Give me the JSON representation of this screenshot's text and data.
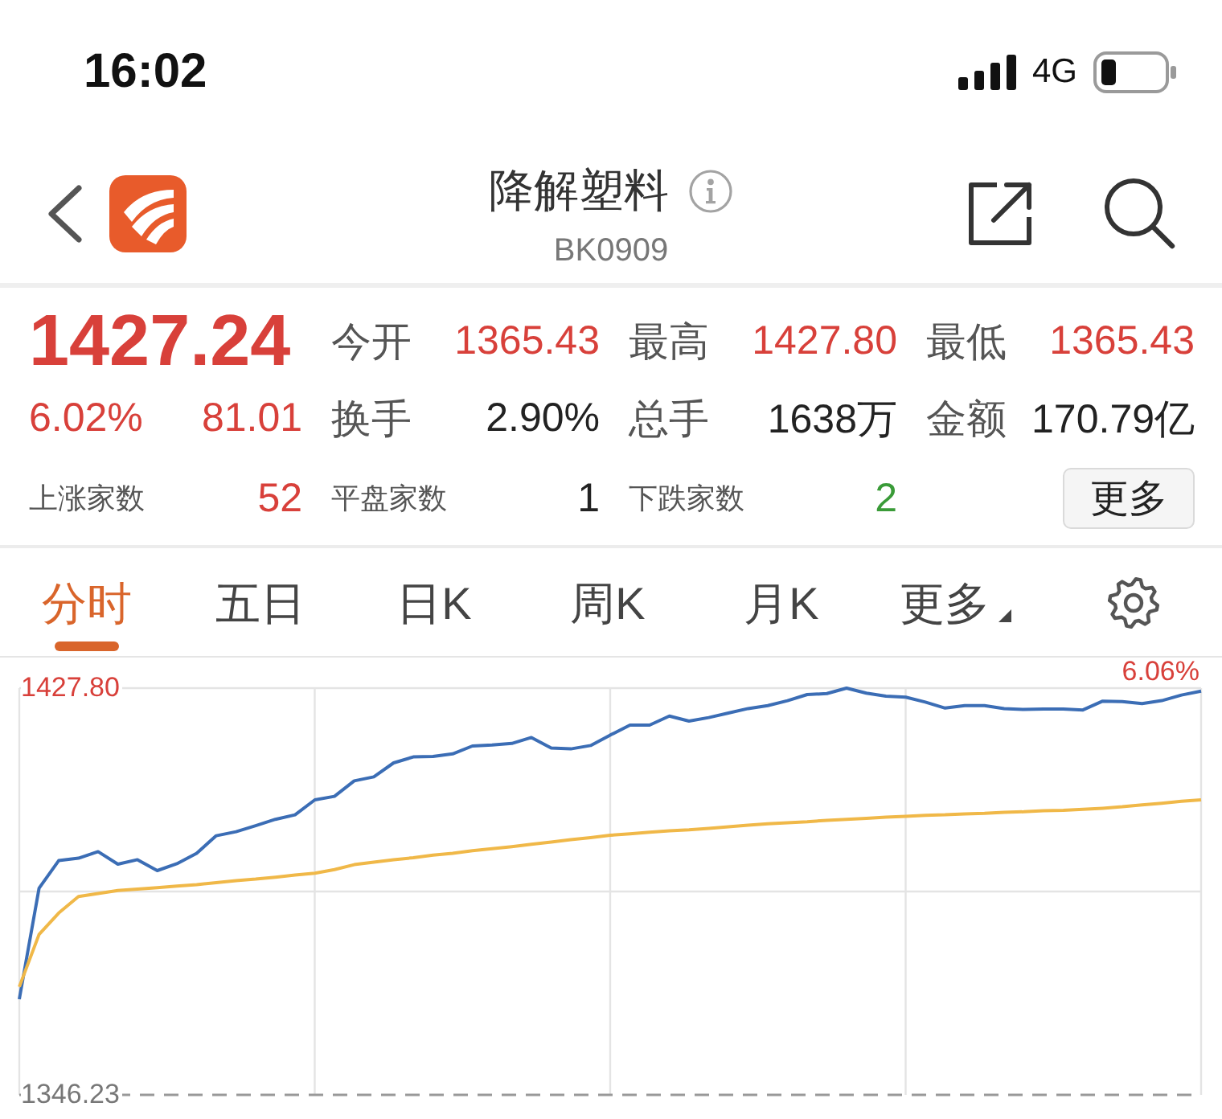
{
  "status_bar": {
    "time": "16:02",
    "network": "4G"
  },
  "header": {
    "title": "降解塑料",
    "code": "BK0909"
  },
  "quote": {
    "price": "1427.24",
    "change_pct": "6.02%",
    "change": "81.01",
    "color": "#d8403a"
  },
  "stats": [
    {
      "label": "今开",
      "value": "1365.43",
      "color": "#d8403a"
    },
    {
      "label": "最高",
      "value": "1427.80",
      "color": "#d8403a"
    },
    {
      "label": "最低",
      "value": "1365.43",
      "color": "#d8403a"
    },
    {
      "label": "换手",
      "value": "2.90%",
      "color": "#222222"
    },
    {
      "label": "总手",
      "value": "1638万",
      "color": "#222222"
    },
    {
      "label": "金额",
      "value": "170.79亿",
      "color": "#222222"
    }
  ],
  "breadth": [
    {
      "label": "上涨家数",
      "value": "52",
      "color": "#d8403a"
    },
    {
      "label": "平盘家数",
      "value": "1",
      "color": "#222222"
    },
    {
      "label": "下跌家数",
      "value": "2",
      "color": "#3a9b38"
    }
  ],
  "more_button": "更多",
  "tabs": [
    {
      "label": "分时",
      "selected": true,
      "kind": "tab"
    },
    {
      "label": "五日",
      "selected": false,
      "kind": "tab"
    },
    {
      "label": "日K",
      "selected": false,
      "kind": "tab"
    },
    {
      "label": "周K",
      "selected": false,
      "kind": "tab"
    },
    {
      "label": "月K",
      "selected": false,
      "kind": "tab"
    },
    {
      "label": "更多",
      "selected": false,
      "kind": "dropdown"
    }
  ],
  "chart": {
    "high_change": "6.06%",
    "chart_data": {
      "type": "line",
      "grid": true,
      "ylim": [
        1346.23,
        1427.8
      ],
      "yticks": [
        {
          "value": 1427.8,
          "label": "1427.80"
        },
        {
          "value": 1346.23,
          "label": "1346.23"
        }
      ],
      "categories": [
        null,
        null,
        null,
        null,
        null,
        null,
        null,
        null,
        null,
        null,
        null,
        null,
        null,
        null,
        null,
        null,
        null,
        null,
        null,
        null,
        null,
        null,
        null,
        null,
        null,
        null,
        null,
        null,
        null,
        null,
        null,
        null,
        null,
        null,
        null,
        null,
        null,
        null,
        null,
        null,
        null,
        null,
        null,
        null,
        null,
        null,
        null,
        null,
        null,
        null,
        null,
        null,
        null,
        null,
        null,
        null,
        null,
        null,
        null,
        null,
        null
      ],
      "series": [
        {
          "color": "#3b6db5",
          "values": [
            1365.4,
            1387.7,
            1393.2,
            1393.7,
            1395.0,
            1392.5,
            1393.4,
            1391.2,
            1392.6,
            1394.7,
            1398.2,
            1399.0,
            1400.2,
            1401.5,
            1402.4,
            1405.4,
            1406.1,
            1409.2,
            1410.0,
            1412.8,
            1414.0,
            1414.1,
            1414.6,
            1416.2,
            1416.4,
            1416.7,
            1417.9,
            1415.8,
            1415.6,
            1416.3,
            1418.4,
            1420.4,
            1420.4,
            1422.2,
            1421.2,
            1421.9,
            1422.8,
            1423.7,
            1424.3,
            1425.3,
            1426.5,
            1426.7,
            1427.8,
            1426.8,
            1426.2,
            1426.0,
            1425.0,
            1423.8,
            1424.3,
            1424.3,
            1423.7,
            1423.5,
            1423.6,
            1423.6,
            1423.4,
            1425.2,
            1425.1,
            1424.7,
            1425.3,
            1426.4,
            1427.2
          ]
        },
        {
          "color": "#f0b848",
          "values": [
            1367.9,
            1378.4,
            1382.7,
            1386.0,
            1386.6,
            1387.2,
            1387.5,
            1387.8,
            1388.1,
            1388.4,
            1388.8,
            1389.2,
            1389.5,
            1389.9,
            1390.3,
            1390.7,
            1391.4,
            1392.4,
            1392.9,
            1393.4,
            1393.8,
            1394.3,
            1394.7,
            1395.2,
            1395.6,
            1396.0,
            1396.5,
            1396.9,
            1397.4,
            1397.8,
            1398.3,
            1398.6,
            1398.9,
            1399.2,
            1399.4,
            1399.7,
            1400.0,
            1400.3,
            1400.6,
            1400.8,
            1401.0,
            1401.3,
            1401.5,
            1401.7,
            1401.9,
            1402.1,
            1402.3,
            1402.4,
            1402.6,
            1402.7,
            1402.9,
            1403.0,
            1403.2,
            1403.3,
            1403.5,
            1403.7,
            1404.0,
            1404.4,
            1404.7,
            1405.1,
            1405.4
          ]
        }
      ]
    }
  }
}
